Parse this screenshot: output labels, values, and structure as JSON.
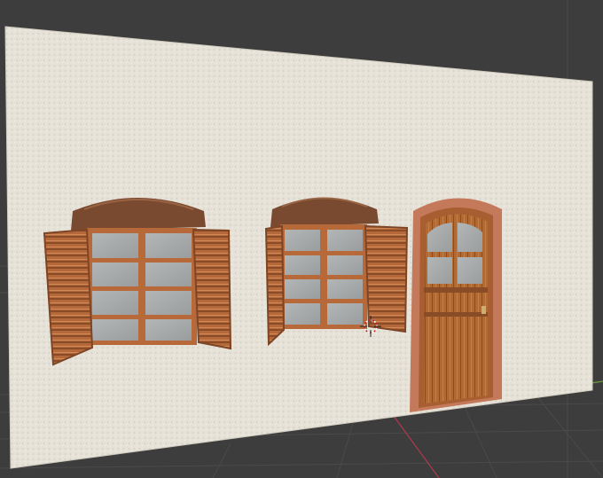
{
  "viewport": {
    "background": "#3d3d3d",
    "grid_line_color": "#4a4a4a",
    "axis_x_color": "#b03a4e",
    "axis_y_color": "#6a9a3a"
  },
  "scene": {
    "wall": {
      "color": "#e6e2d8",
      "shade_color": "#d4cfc3"
    },
    "wood": {
      "frame": "#b8693a",
      "dark": "#7d4526",
      "mid": "#a85e30",
      "light": "#c98553"
    },
    "glass": "#a7aaab",
    "arch_top": "#7a4a30",
    "door_surround": "#c47a5a",
    "handle": "#c9b070",
    "objects": [
      "window-left",
      "window-middle",
      "door"
    ],
    "cursor_icon": "3d-cursor-icon"
  }
}
